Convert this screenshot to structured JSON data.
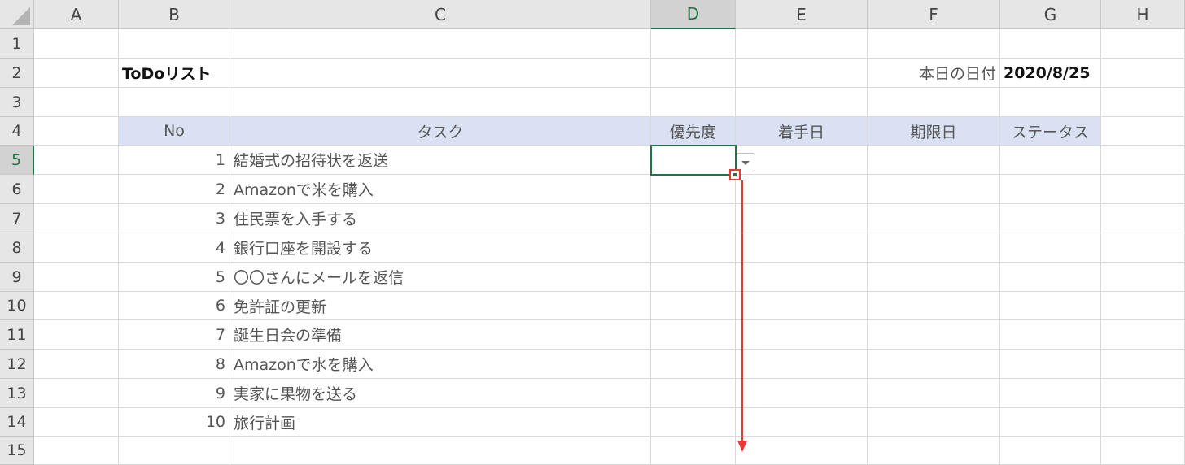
{
  "columns": [
    "A",
    "B",
    "C",
    "D",
    "E",
    "F",
    "G",
    "H"
  ],
  "rows": [
    "1",
    "2",
    "3",
    "4",
    "5",
    "6",
    "7",
    "8",
    "9",
    "10",
    "11",
    "12",
    "13",
    "14",
    "15"
  ],
  "title": "ToDoリスト",
  "date_label": "本日の日付",
  "date_value": "2020/8/25",
  "headers": {
    "no": "No",
    "task": "タスク",
    "priority": "優先度",
    "start": "着手日",
    "due": "期限日",
    "status": "ステータス"
  },
  "tasks": [
    {
      "no": "1",
      "task": "結婚式の招待状を返送"
    },
    {
      "no": "2",
      "task": "Amazonで米を購入"
    },
    {
      "no": "3",
      "task": "住民票を入手する"
    },
    {
      "no": "4",
      "task": "銀行口座を開設する"
    },
    {
      "no": "5",
      "task": "〇〇さんにメールを返信"
    },
    {
      "no": "6",
      "task": "免許証の更新"
    },
    {
      "no": "7",
      "task": "誕生日会の準備"
    },
    {
      "no": "8",
      "task": "Amazonで水を購入"
    },
    {
      "no": "9",
      "task": "実家に果物を送る"
    },
    {
      "no": "10",
      "task": "旅行計画"
    }
  ],
  "selected_cell": "D5",
  "accent_color": "#217346",
  "arrow_color": "#e53935"
}
